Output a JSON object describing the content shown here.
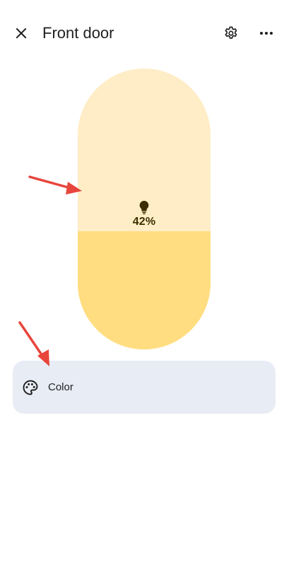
{
  "header": {
    "title": "Front door",
    "close_icon": "close-icon",
    "settings_icon": "gear-icon",
    "more_icon": "more-horizontal-icon"
  },
  "brightness": {
    "value_label": "42%",
    "level": 0.42,
    "icon": "lightbulb-icon",
    "colors": {
      "track": "#feedc6",
      "fill": "#ffdd80",
      "text": "#3d2e00"
    }
  },
  "color_row": {
    "label": "Color",
    "icon": "palette-icon",
    "background": "#e8ecf5"
  },
  "annotations": {
    "arrow_color": "#e8453c"
  }
}
